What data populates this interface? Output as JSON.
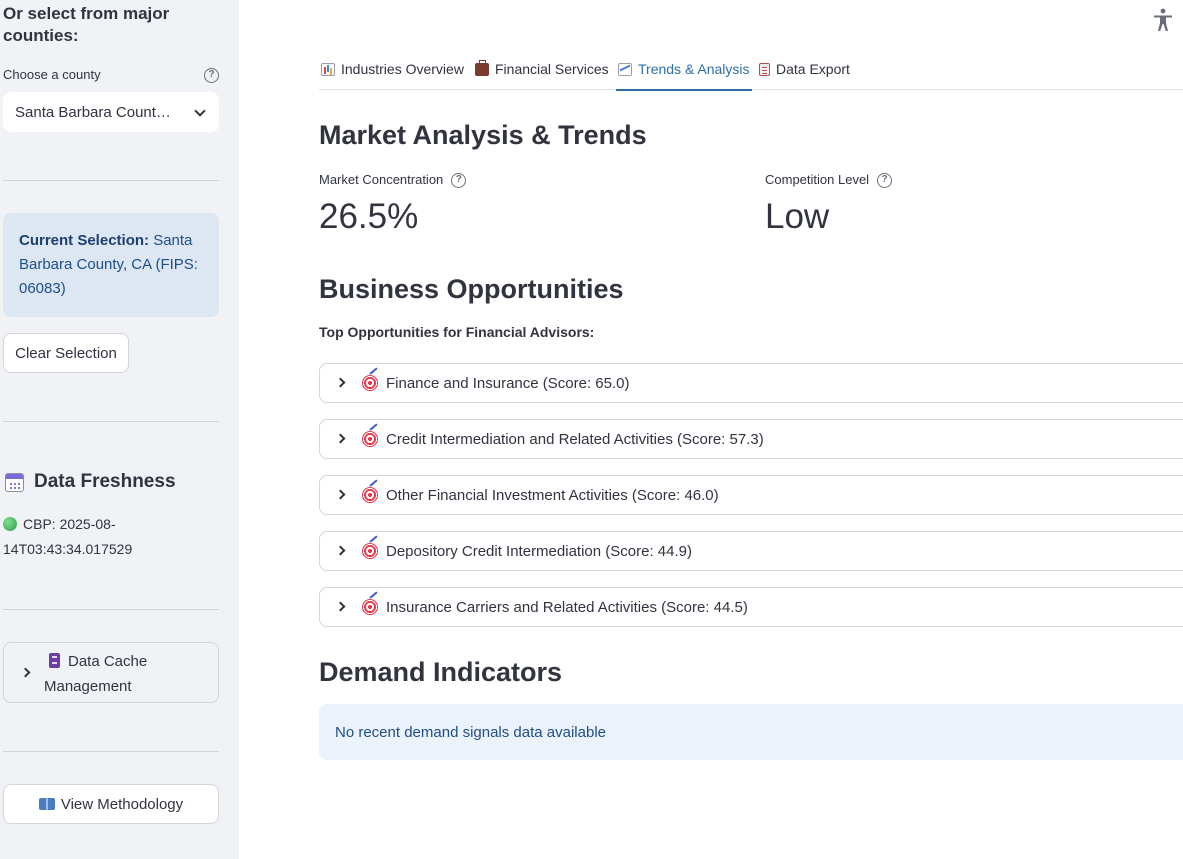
{
  "sidebar": {
    "heading": "Or select from major counties:",
    "county_label": "Choose a county",
    "county_selected": "Santa Barbara Count…",
    "current_selection_label": "Current Selection:",
    "current_selection_value": "Santa Barbara County, CA (FIPS: 06083)",
    "clear_button": "Clear Selection",
    "freshness_title": "Data Freshness",
    "freshness_text": "CBP: 2025-08-14T03:43:34.017529",
    "cache_expander": "Data Cache Management",
    "methodology_button": "View Methodology"
  },
  "tabs": [
    {
      "label": "Industries Overview",
      "icon": "bar-chart-icon"
    },
    {
      "label": "Financial Services",
      "icon": "briefcase-icon"
    },
    {
      "label": "Trends & Analysis",
      "icon": "chart-trend-icon",
      "active": true
    },
    {
      "label": "Data Export",
      "icon": "clipboard-icon"
    }
  ],
  "main": {
    "section_title": "Market Analysis & Trends",
    "metrics": [
      {
        "label": "Market Concentration",
        "value": "26.5%"
      },
      {
        "label": "Competition Level",
        "value": "Low"
      }
    ],
    "opportunities_title": "Business Opportunities",
    "opportunities_subtitle": "Top Opportunities for Financial Advisors:",
    "opportunities": [
      "Finance and Insurance (Score: 65.0)",
      "Credit Intermediation and Related Activities (Score: 57.3)",
      "Other Financial Investment Activities (Score: 46.0)",
      "Depository Credit Intermediation (Score: 44.9)",
      "Insurance Carriers and Related Activities (Score: 44.5)"
    ],
    "demand_title": "Demand Indicators",
    "demand_notice": "No recent demand signals data available"
  },
  "colors": {
    "accent": "#2e6fa7",
    "sidebar_bg": "#f0f2f6",
    "info_bg": "#dde6f3",
    "notice_bg": "#ecf2fb"
  }
}
